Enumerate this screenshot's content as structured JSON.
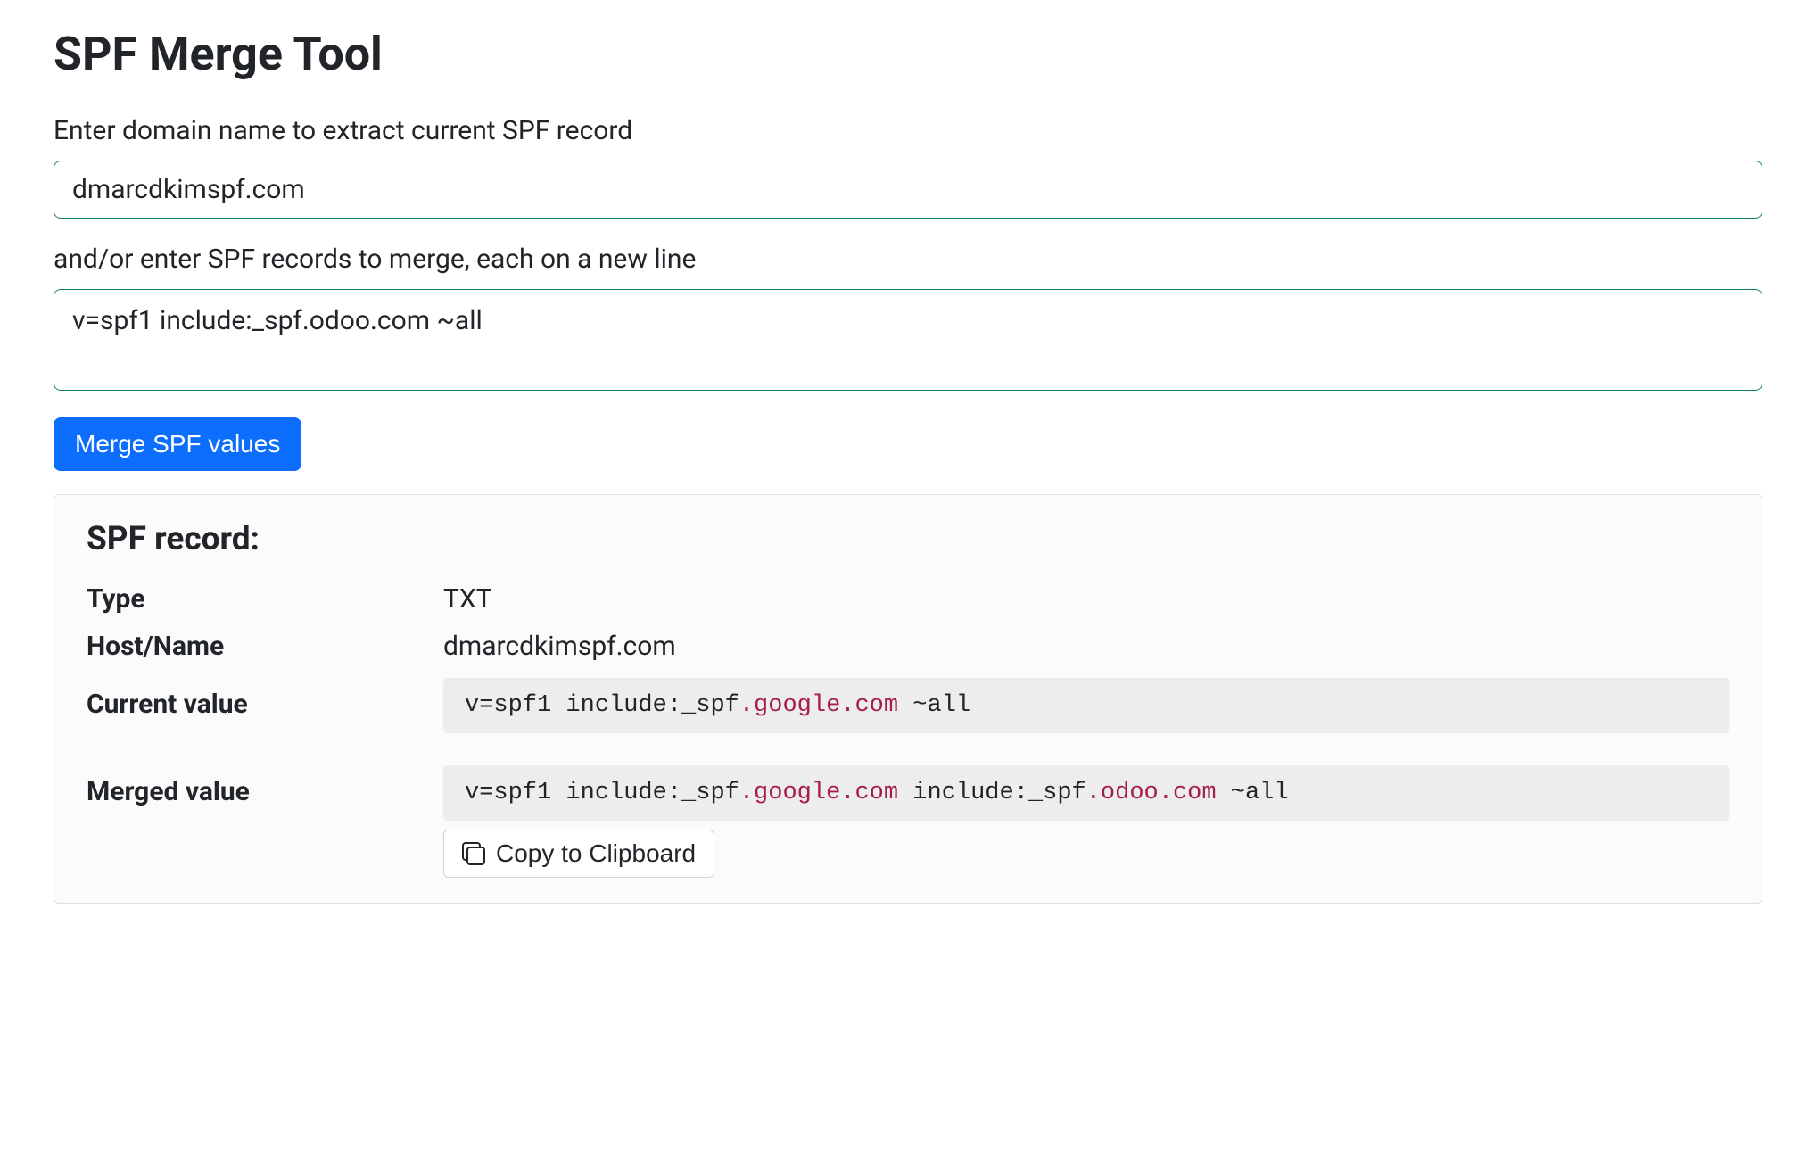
{
  "page_title": "SPF Merge Tool",
  "form": {
    "domain_label": "Enter domain name to extract current SPF record",
    "domain_value": "dmarcdkimspf.com",
    "records_label": "and/or enter SPF records to merge, each on a new line",
    "records_value": "v=spf1 include:_spf.odoo.com ~all",
    "submit_label": "Merge SPF values"
  },
  "results": {
    "heading": "SPF record:",
    "type_label": "Type",
    "type_value": "TXT",
    "host_label": "Host/Name",
    "host_value": "dmarcdkimspf.com",
    "current_label": "Current value",
    "current_value_prefix": "v=spf1 include:_spf",
    "current_value_hl1": ".google.com",
    "current_value_suffix": " ~all",
    "merged_label": "Merged value",
    "merged_value_a": "v=spf1 include:_spf",
    "merged_value_hl1": ".google.com",
    "merged_value_b": " include:_spf",
    "merged_value_hl2": ".odoo.com",
    "merged_value_c": " ~all",
    "copy_label": "Copy to Clipboard"
  }
}
